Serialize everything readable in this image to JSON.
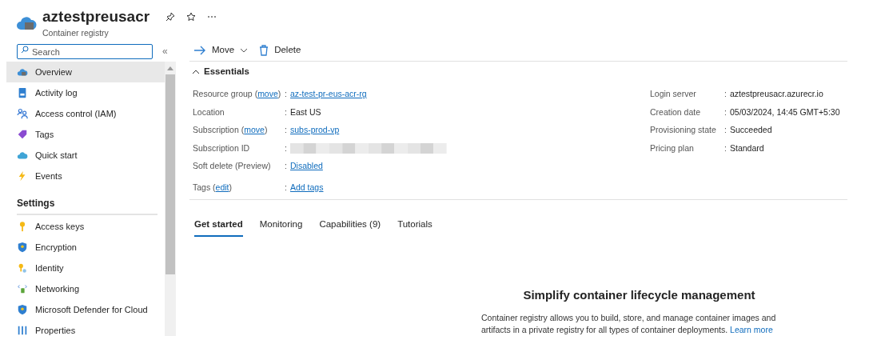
{
  "header": {
    "title": "aztestpreusacr",
    "subtitle": "Container registry"
  },
  "sidebar": {
    "search": {
      "placeholder": "Search"
    },
    "collapse": "«",
    "items": [
      {
        "label": "Overview",
        "kind": "cloud",
        "selected": true
      },
      {
        "label": "Activity log",
        "kind": "log",
        "selected": false
      },
      {
        "label": "Access control (IAM)",
        "kind": "people",
        "selected": false
      },
      {
        "label": "Tags",
        "kind": "tag",
        "selected": false
      },
      {
        "label": "Quick start",
        "kind": "quickstart",
        "selected": false
      },
      {
        "label": "Events",
        "kind": "bolt",
        "selected": false
      }
    ],
    "sections": [
      {
        "title": "Settings",
        "items": [
          {
            "label": "Access keys",
            "kind": "key",
            "selected": false
          },
          {
            "label": "Encryption",
            "kind": "shield",
            "selected": false
          },
          {
            "label": "Identity",
            "kind": "identity",
            "selected": false
          },
          {
            "label": "Networking",
            "kind": "network",
            "selected": false
          },
          {
            "label": "Microsoft Defender for Cloud",
            "kind": "shield",
            "selected": false
          },
          {
            "label": "Properties",
            "kind": "bars",
            "selected": false
          }
        ]
      }
    ]
  },
  "toolbar": [
    {
      "label": "Move",
      "kind": "arrow",
      "dropdown": true
    },
    {
      "label": "Delete",
      "kind": "trash",
      "dropdown": false
    }
  ],
  "essentials": {
    "title": "Essentials",
    "expanded": true,
    "left": [
      {
        "label": "Resource group (",
        "label_link": "move",
        "label_end": ")",
        "sep": ":",
        "value": "az-test-pr-eus-acr-rg",
        "kind": "link"
      },
      {
        "label": "Location",
        "sep": ":",
        "value": "East US",
        "kind": "text"
      },
      {
        "label": "Subscription (",
        "label_link": "move",
        "label_end": ")",
        "sep": ":",
        "value": "subs-prod-vp",
        "kind": "link"
      },
      {
        "label": "Subscription ID",
        "sep": ":",
        "kind": "redacted"
      },
      {
        "label": "Soft delete (Preview)",
        "sep": ":",
        "value": "Disabled",
        "kind": "link"
      },
      {
        "label": "Tags (",
        "label_link": "edit",
        "label_end": ")",
        "sep": ":",
        "value": "Add tags",
        "kind": "link"
      }
    ],
    "right": [
      {
        "label": "Login server",
        "sep": ":",
        "value": "aztestpreusacr.azurecr.io",
        "kind": "text"
      },
      {
        "label": "Creation date",
        "sep": ":",
        "value": "05/03/2024, 14:45 GMT+5:30",
        "kind": "text"
      },
      {
        "label": "Provisioning state",
        "sep": ":",
        "value": "Succeeded",
        "kind": "text"
      },
      {
        "label": "Pricing plan",
        "sep": ":",
        "value": "Standard",
        "kind": "text"
      }
    ]
  },
  "tabs": [
    {
      "label": "Get started",
      "selected": true
    },
    {
      "label": "Monitoring",
      "selected": false
    },
    {
      "label": "Capabilities (9)",
      "selected": false
    },
    {
      "label": "Tutorials",
      "selected": false
    }
  ],
  "panel": {
    "heading": "Simplify container lifecycle management",
    "text": "Container registry allows you to build, store, and manage container images and artifacts in a private registry for all types of container deployments.",
    "link": "Learn more"
  }
}
